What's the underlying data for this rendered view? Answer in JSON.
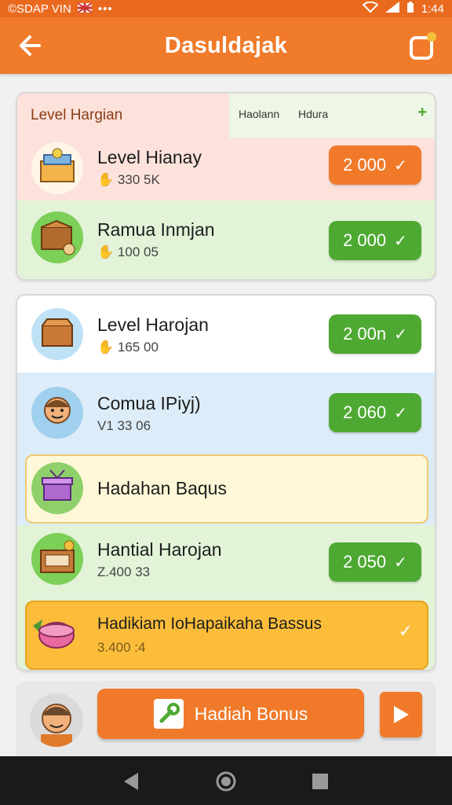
{
  "status_bar": {
    "left_text": "©SDAP VIN",
    "time": "1:44"
  },
  "app_bar": {
    "title": "Dasuldajak"
  },
  "card1": {
    "header_label": "Level Hargian",
    "header_col1": "Haolann",
    "header_col2": "Hdura",
    "header_action": "+",
    "rows": [
      {
        "title": "Level Hianay",
        "subtitle": "330 5K",
        "value": "2 000",
        "check": "✓"
      },
      {
        "title": "Ramua Inmjan",
        "subtitle": "100 05",
        "value": "2 000",
        "check": "✓"
      }
    ]
  },
  "card2": {
    "rows": [
      {
        "title": "Level Harojan",
        "subtitle": "165 00",
        "value": "2 00n",
        "check": "✓"
      },
      {
        "title": "Comua IPiyj)",
        "subtitle": "V1 33 06",
        "value": "2 060",
        "check": "✓"
      },
      {
        "title": "Hadahan Baqus"
      },
      {
        "title": "Hantial Harojan",
        "subtitle": "Z.400 33",
        "value": "2 050",
        "check": "✓"
      },
      {
        "title": "Hadikiam IoHapaikaha Bassus",
        "subtitle": "3.400 :4",
        "check": "✓"
      }
    ]
  },
  "bottom_bar": {
    "bonus_label": "Hadiah Bonus"
  },
  "colors": {
    "accent_orange": "#f07a2a",
    "accent_green": "#4ea932",
    "row_pink": "#fde2dc",
    "row_green": "#e2f3d8",
    "row_blue": "#dcecf8",
    "row_cream": "#fff8d8",
    "row_yellow": "#fbbd3a"
  },
  "icons": {
    "status": [
      "signal-icon",
      "wifi-icon",
      "battery-icon"
    ],
    "app_bar": [
      "back-arrow-icon",
      "notification-icon"
    ],
    "nav": [
      "nav-back-icon",
      "nav-home-icon",
      "nav-recents-icon"
    ]
  }
}
